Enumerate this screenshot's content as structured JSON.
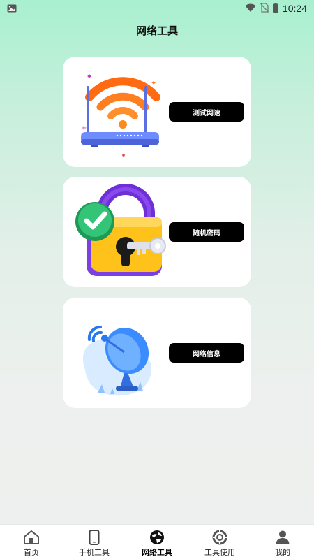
{
  "status_bar": {
    "time": "10:24",
    "icons": [
      "image-icon",
      "wifi-icon",
      "no-sim-icon",
      "battery-icon"
    ]
  },
  "header": {
    "title": "网络工具"
  },
  "tools": [
    {
      "label": "测试网速",
      "icon": "wifi-router-illustration"
    },
    {
      "label": "随机密码",
      "icon": "padlock-key-illustration"
    },
    {
      "label": "网络信息",
      "icon": "satellite-dish-illustration"
    }
  ],
  "bottom_nav": {
    "items": [
      {
        "label": "首页",
        "icon": "home-icon",
        "active": false
      },
      {
        "label": "手机工具",
        "icon": "phone-icon",
        "active": false
      },
      {
        "label": "网络工具",
        "icon": "globe-icon",
        "active": true
      },
      {
        "label": "工具使用",
        "icon": "lifebuoy-icon",
        "active": false
      },
      {
        "label": "我的",
        "icon": "user-icon",
        "active": false
      }
    ]
  },
  "colors": {
    "accent_orange": "#ff7a18",
    "lock_purple": "#7b3fe4",
    "lock_yellow": "#ffc21a",
    "check_green": "#2fb36b",
    "dish_blue": "#3b8cff",
    "button_black": "#000000"
  }
}
